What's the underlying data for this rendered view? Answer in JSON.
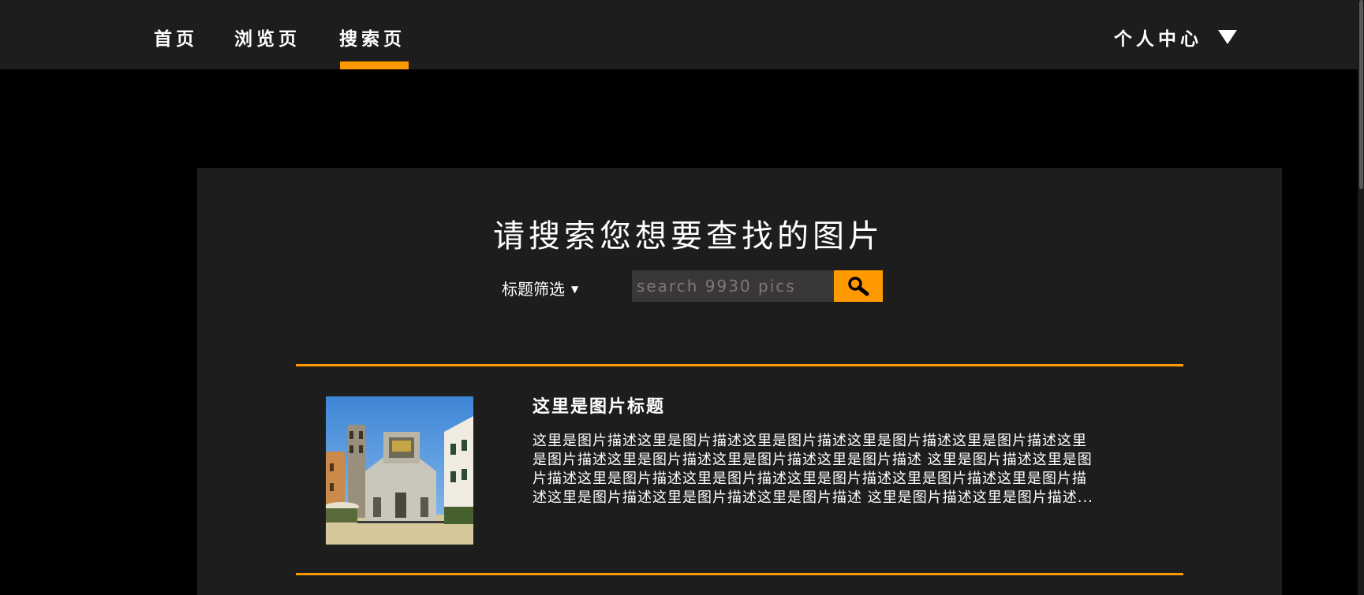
{
  "nav": {
    "items": [
      {
        "label": "首页"
      },
      {
        "label": "浏览页"
      },
      {
        "label": "搜索页"
      }
    ],
    "active_index": 2,
    "user_center_label": "个人中心",
    "user_center_icon": "caret-down-icon"
  },
  "colors": {
    "accent": "#ff9900",
    "navbar_bg": "#1d1d1d",
    "page_bg": "#000000",
    "panel_bg": "#1d1d1d",
    "input_bg": "#3a3737"
  },
  "search": {
    "title": "请搜索您想要查找的图片",
    "filter_label": "标题筛选",
    "filter_icon": "caret-down-icon",
    "placeholder": "search 9930 pics",
    "value": "",
    "button_icon": "search-icon"
  },
  "results": [
    {
      "title": "这里是图片标题",
      "description_lines": [
        "这里是图片描述这里是图片描述这里是图片描述这里是图片描述这里是图片描述这里",
        "是图片描述这里是图片描述这里是图片描述这里是图片描述 这里是图片描述这里是图",
        "片描述这里是图片描述这里是图片描述这里是图片描述这里是图片描述这里是图片描",
        "述这里是图片描述这里是图片描述这里是图片描述 这里是图片描述这里是图片描述..."
      ],
      "thumbnail": "church-photo"
    }
  ]
}
